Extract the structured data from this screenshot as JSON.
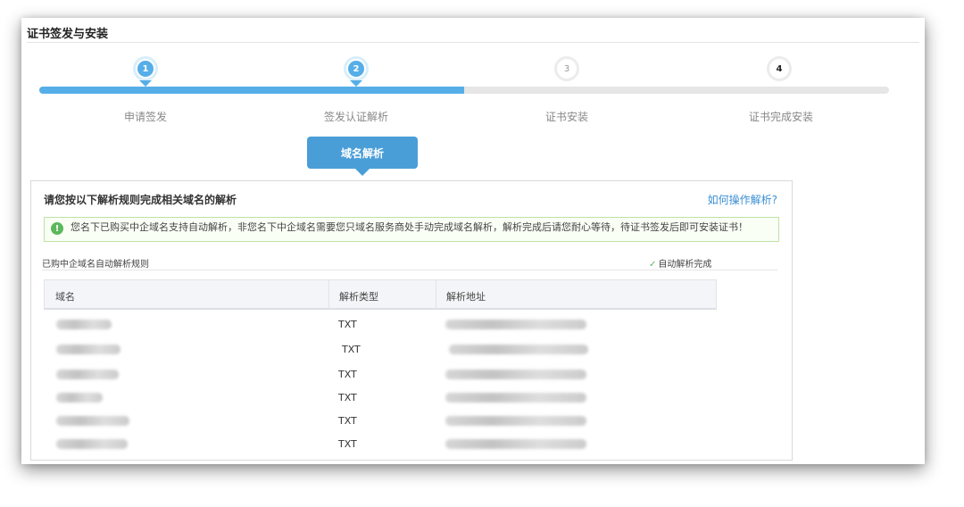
{
  "page": {
    "title": "证书签发与安装"
  },
  "stepper": {
    "progress": 0.5,
    "steps": [
      {
        "number": "1",
        "label": "申请签发",
        "state": "done"
      },
      {
        "number": "2",
        "label": "签发认证解析",
        "state": "active"
      },
      {
        "number": "3",
        "label": "证书安装",
        "state": "todo"
      },
      {
        "number": "4",
        "label": "证书完成安装",
        "state": "todo"
      }
    ],
    "active_detail": "域名解析"
  },
  "panel": {
    "header": "请您按以下解析规则完成相关域名的解析",
    "help_link": "如何操作解析?",
    "notice": "您名下已购买中企域名支持自动解析，非您名下中企域名需要您只域名服务商处手动完成域名解析，解析完成后请您耐心等待，待证书签发后即可安装证书！",
    "rules_caption": "已购中企域名自动解析规则",
    "status": "自动解析完成",
    "table": {
      "columns": [
        "域名",
        "解析类型",
        "解析地址"
      ],
      "rows": [
        {
          "type": "TXT"
        },
        {
          "type": "TXT"
        },
        {
          "type": "TXT"
        },
        {
          "type": "TXT"
        },
        {
          "type": "TXT"
        },
        {
          "type": "TXT"
        }
      ]
    }
  },
  "colors": {
    "accent": "#56aee8",
    "callout": "#4a9ed8",
    "link": "#3a8fd4",
    "success": "#5cb85c"
  },
  "icons": {
    "notice": "exclamation-circle-icon",
    "status": "check-icon"
  }
}
